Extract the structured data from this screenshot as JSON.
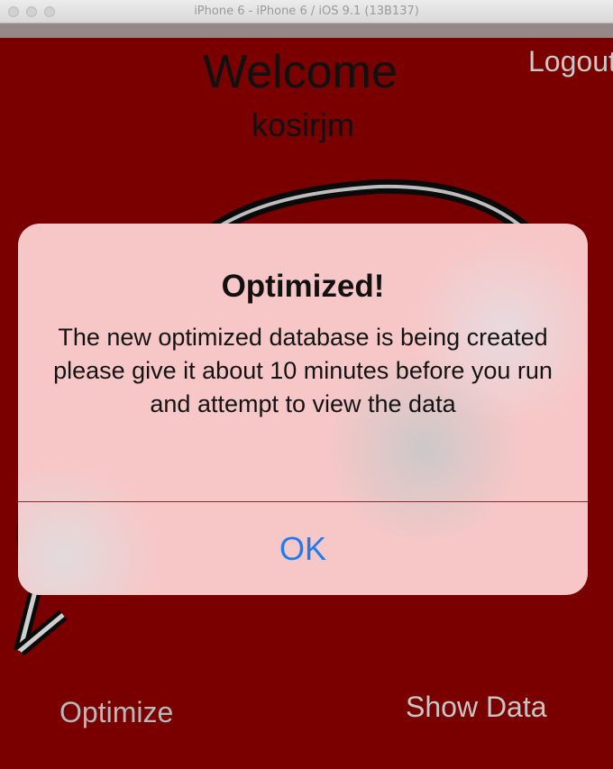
{
  "window": {
    "title": "iPhone 6 - iPhone 6 / iOS 9.1 (13B137)"
  },
  "screen": {
    "welcome": "Welcome",
    "username": "kosirjm",
    "logout_label": "Logout",
    "optimize_label": "Optimize",
    "show_data_label": "Show Data"
  },
  "alert": {
    "title": "Optimized!",
    "message": "The new optimized database is being created please give it about 10 minutes before you run and attempt to view the data",
    "ok_label": "OK"
  },
  "colors": {
    "background": "#7a0000",
    "alert_background": "#f7c7c7",
    "ok_button": "#1f7bf0"
  }
}
